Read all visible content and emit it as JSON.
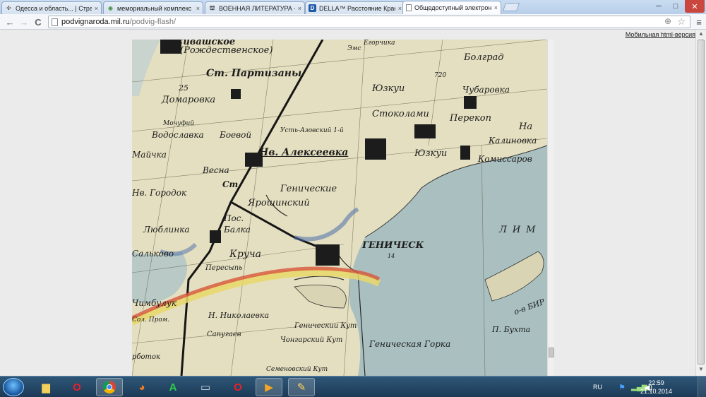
{
  "browser": {
    "tabs": [
      {
        "title": "Одесса и область... | Страс",
        "icon": "puzzle-icon"
      },
      {
        "title": "мемориальный комплекс",
        "icon": "google-maps-icon"
      },
      {
        "title": "ВОЕННАЯ ЛИТЕРАТУРА --[",
        "icon": "militera-icon"
      },
      {
        "title": "DELLA™ Расстояние Красн",
        "icon": "della-icon"
      },
      {
        "title": "Общедоступный электрон",
        "icon": "page-icon"
      }
    ],
    "tab_close_glyph": "×",
    "window_controls": {
      "minimize": "─",
      "maximize": "□",
      "close": "✕"
    },
    "nav": {
      "back": "←",
      "forward": "→",
      "reload": "C"
    },
    "address": {
      "domain": "podvignaroda.mil.ru",
      "path": "/podvig-flash/"
    }
  },
  "page": {
    "mobile_link": "Мобильная html-версия"
  },
  "map_labels": [
    "Сивашское",
    "(Рождественское)",
    "Эмс",
    "Егорчика",
    "Болград",
    "Ст. Партизаны",
    "720",
    "25",
    "Юзкуи",
    "Чубаровка",
    "Домаровка",
    "Стоколами",
    "Перекоп",
    "Мочуфий",
    "Водославка",
    "Боевой",
    "Усть-Азовский 1-й",
    "На",
    "Майчка",
    "Нв. Алексеевка",
    "Юзкуи",
    "Калиновка",
    "Весна",
    "Комиссаров",
    "Ст.",
    "Нв. Городок",
    "Генические",
    "Ярошинский",
    "Пос.",
    "Люблинка",
    "Балка",
    "ГЕНИЧЕСК",
    "14",
    "Сальково",
    "Круча",
    "Пересыпь",
    "ЛИМ",
    "Чимбулук",
    "о-в БИР",
    "Н. Николаевка",
    "Сол. Пром.",
    "Геническии Кут",
    "П. Бухта",
    "Сапугаев",
    "Чонгарский Кут",
    "Геническая Горка",
    "рботок",
    "Семеновский Кут"
  ],
  "taskbar": {
    "apps": [
      "explorer",
      "opera",
      "chrome",
      "firefox",
      "aimp",
      "monitor",
      "opera",
      "media-player",
      "paint"
    ],
    "language": "RU",
    "time": "22:59",
    "date": "21.10.2014"
  },
  "colors": {
    "land": "#e4dfc0",
    "sea": "#a9bfc0",
    "ink": "#1c1c1c",
    "red_line": "#d8553a",
    "yellow_line": "#e9d86a"
  }
}
